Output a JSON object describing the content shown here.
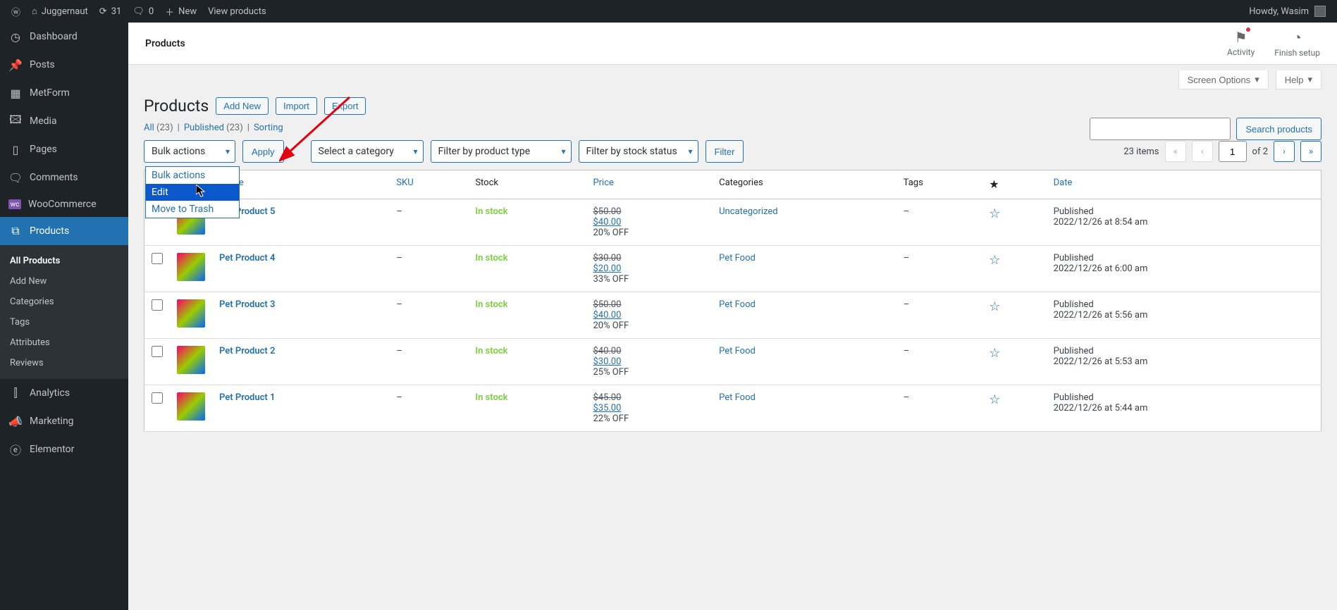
{
  "adminbar": {
    "site": "Juggernaut",
    "updates": "31",
    "comments": "0",
    "new": "New",
    "view": "View products",
    "howdy": "Howdy, Wasim"
  },
  "sidebar": {
    "items": [
      {
        "label": "Dashboard",
        "icon": "⌂"
      },
      {
        "label": "Posts",
        "icon": "✎"
      },
      {
        "label": "MetForm",
        "icon": "▦"
      },
      {
        "label": "Media",
        "icon": "✿"
      },
      {
        "label": "Pages",
        "icon": "▭"
      },
      {
        "label": "Comments",
        "icon": "🗨"
      },
      {
        "label": "WooCommerce",
        "icon": "ⓦ"
      },
      {
        "label": "Products",
        "icon": "⧉",
        "active": true
      },
      {
        "label": "Analytics",
        "icon": "⫿"
      },
      {
        "label": "Marketing",
        "icon": "📣"
      },
      {
        "label": "Elementor",
        "icon": "ⓔ"
      }
    ],
    "sub": {
      "items": [
        {
          "label": "All Products",
          "active": true
        },
        {
          "label": "Add New"
        },
        {
          "label": "Categories"
        },
        {
          "label": "Tags"
        },
        {
          "label": "Attributes"
        },
        {
          "label": "Reviews"
        }
      ]
    }
  },
  "topnav": {
    "title": "Products",
    "activity": "Activity",
    "finish": "Finish setup"
  },
  "screen_meta": {
    "screen_options": "Screen Options",
    "help": "Help"
  },
  "heading": {
    "title": "Products",
    "add_new": "Add New",
    "import": "Import",
    "export": "Export"
  },
  "subsubsub": {
    "all": "All",
    "all_count": "(23)",
    "published": "Published",
    "published_count": "(23)",
    "sorting": "Sorting",
    "sep": " | "
  },
  "filters": {
    "bulk": "Bulk actions",
    "apply": "Apply",
    "cat": "Select a category",
    "type": "Filter by product type",
    "stock": "Filter by stock status",
    "filter": "Filter"
  },
  "bulk_dropdown": {
    "opt0": "Bulk actions",
    "opt1": "Edit",
    "opt2": "Move to Trash"
  },
  "search": {
    "button": "Search products"
  },
  "pagination": {
    "items": "23 items",
    "page": "1",
    "of": "of 2"
  },
  "table": {
    "headers": {
      "name": "Name",
      "sku": "SKU",
      "stock": "Stock",
      "price": "Price",
      "categories": "Categories",
      "tags": "Tags",
      "star": "★",
      "date": "Date"
    },
    "rows": [
      {
        "name": "Pet Product 5",
        "sku": "–",
        "stock": "In stock",
        "old": "$50.00",
        "new": "$40.00",
        "off": "20% OFF",
        "cat": "Uncategorized",
        "tags": "–",
        "pub": "Published",
        "date": "2022/12/26 at 8:54 am"
      },
      {
        "name": "Pet Product 4",
        "sku": "–",
        "stock": "In stock",
        "old": "$30.00",
        "new": "$20.00",
        "off": "33% OFF",
        "cat": "Pet Food",
        "tags": "–",
        "pub": "Published",
        "date": "2022/12/26 at 6:00 am"
      },
      {
        "name": "Pet Product 3",
        "sku": "–",
        "stock": "In stock",
        "old": "$50.00",
        "new": "$40.00",
        "off": "20% OFF",
        "cat": "Pet Food",
        "tags": "–",
        "pub": "Published",
        "date": "2022/12/26 at 5:56 am"
      },
      {
        "name": "Pet Product 2",
        "sku": "–",
        "stock": "In stock",
        "old": "$40.00",
        "new": "$30.00",
        "off": "25% OFF",
        "cat": "Pet Food",
        "tags": "–",
        "pub": "Published",
        "date": "2022/12/26 at 5:53 am"
      },
      {
        "name": "Pet Product 1",
        "sku": "–",
        "stock": "In stock",
        "old": "$45.00",
        "new": "$35.00",
        "off": "22% OFF",
        "cat": "Pet Food",
        "tags": "–",
        "pub": "Published",
        "date": "2022/12/26 at 5:44 am"
      }
    ]
  }
}
